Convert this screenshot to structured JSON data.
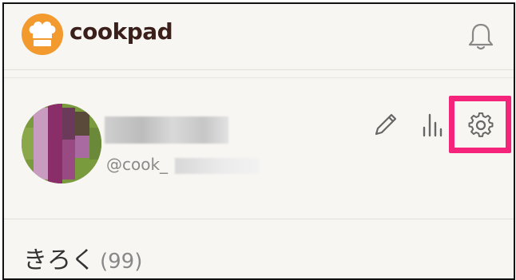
{
  "header": {
    "brand": "cookpad",
    "icons": {
      "logo": "chef-hat-icon",
      "notifications": "bell-icon"
    },
    "colors": {
      "brand": "#f29a2e",
      "brand_text": "#3a1f1a"
    }
  },
  "profile": {
    "handle_prefix": "@cook_",
    "actions": [
      {
        "name": "edit",
        "icon": "pencil-icon"
      },
      {
        "name": "stats",
        "icon": "bar-chart-icon"
      },
      {
        "name": "settings",
        "icon": "gear-icon",
        "highlighted": true
      }
    ],
    "highlight_color": "#f5237a"
  },
  "records": {
    "title": "きろく",
    "count": "(99)"
  }
}
